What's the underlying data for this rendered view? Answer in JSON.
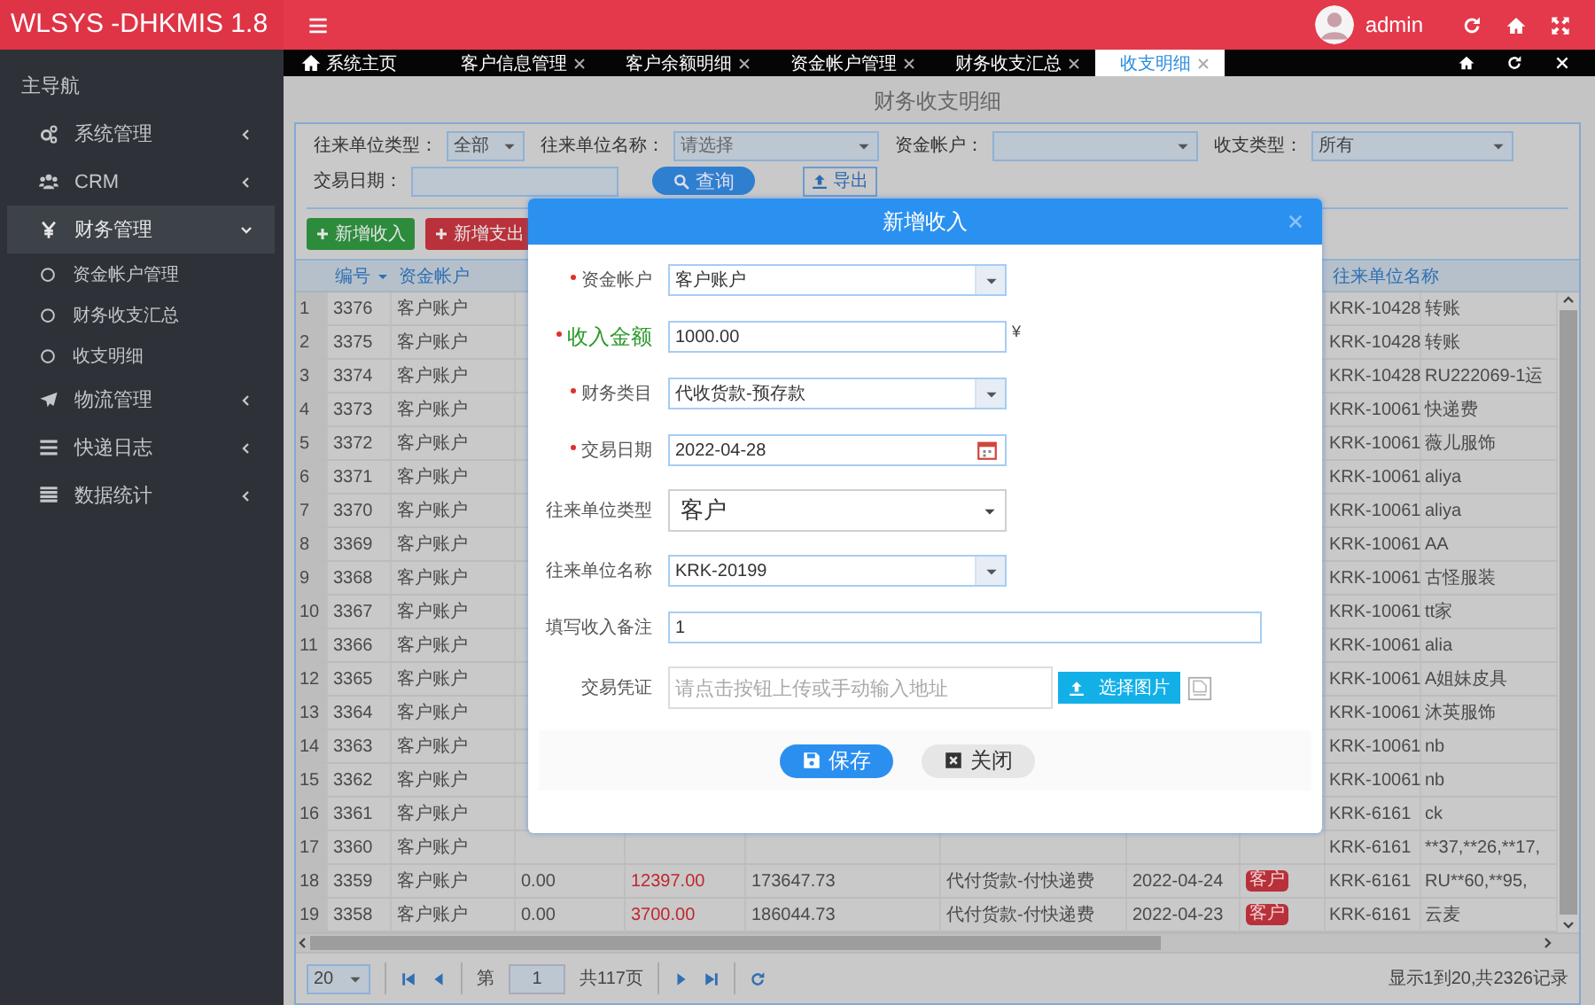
{
  "header": {
    "logo": "WLSYS -DHKMIS 1.8",
    "user": "admin"
  },
  "sidebar": {
    "heading": "主导航",
    "items": [
      {
        "label": "系统管理",
        "expanded": false
      },
      {
        "label": "CRM",
        "expanded": false
      },
      {
        "label": "财务管理",
        "expanded": true,
        "children": [
          {
            "label": "资金帐户管理"
          },
          {
            "label": "财务收支汇总"
          },
          {
            "label": "收支明细"
          }
        ]
      },
      {
        "label": "物流管理",
        "expanded": false
      },
      {
        "label": "快递日志",
        "expanded": false
      },
      {
        "label": "数据统计",
        "expanded": false
      }
    ]
  },
  "tabs": [
    {
      "label": "系统主页",
      "kind": "home",
      "selected": false
    },
    {
      "label": "客户信息管理",
      "kind": "closable",
      "selected": false
    },
    {
      "label": "客户余额明细",
      "kind": "closable",
      "selected": false
    },
    {
      "label": "资金帐户管理",
      "kind": "closable",
      "selected": false
    },
    {
      "label": "财务收支汇总",
      "kind": "closable",
      "selected": false
    },
    {
      "label": "收支明细",
      "kind": "closable",
      "selected": true
    }
  ],
  "page": {
    "title": "财务收支明细",
    "filters": [
      {
        "label": "往来单位类型：",
        "value": "全部"
      },
      {
        "label": "往来单位名称：",
        "placeholder": "请选择"
      },
      {
        "label": "资金帐户："
      },
      {
        "label": "收支类型：",
        "value": "所有"
      }
    ],
    "date_filter": {
      "label": "交易日期："
    },
    "search_button": "查询",
    "export_button": "导出",
    "actions": [
      {
        "label": "新增收入",
        "kind": "income"
      },
      {
        "label": "新增支出",
        "kind": "expense"
      }
    ],
    "table": {
      "columns": [
        {
          "label": "编号",
          "sorted": true
        },
        {
          "label": "资金帐户",
          "sorted": false
        },
        {
          "label": "往来单位名称",
          "sorted": false
        }
      ],
      "rows": [
        {
          "no": "1",
          "id": "3376",
          "account": "客户账户",
          "partner": "KRK-10428",
          "remark": "转账"
        },
        {
          "no": "2",
          "id": "3375",
          "account": "客户账户",
          "partner": "KRK-10428",
          "remark": "转账"
        },
        {
          "no": "3",
          "id": "3374",
          "account": "客户账户",
          "partner": "KRK-10428",
          "remark": "RU222069-1运"
        },
        {
          "no": "4",
          "id": "3373",
          "account": "客户账户",
          "partner": "KRK-10061",
          "remark": "快递费"
        },
        {
          "no": "5",
          "id": "3372",
          "account": "客户账户",
          "partner": "KRK-10061",
          "remark": "薇儿服饰"
        },
        {
          "no": "6",
          "id": "3371",
          "account": "客户账户",
          "partner": "KRK-10061",
          "remark": "aliya"
        },
        {
          "no": "7",
          "id": "3370",
          "account": "客户账户",
          "partner": "KRK-10061",
          "remark": "aliya"
        },
        {
          "no": "8",
          "id": "3369",
          "account": "客户账户",
          "partner": "KRK-10061",
          "remark": "AA"
        },
        {
          "no": "9",
          "id": "3368",
          "account": "客户账户",
          "partner": "KRK-10061",
          "remark": "古怪服装"
        },
        {
          "no": "10",
          "id": "3367",
          "account": "客户账户",
          "partner": "KRK-10061",
          "remark": "tt家"
        },
        {
          "no": "11",
          "id": "3366",
          "account": "客户账户",
          "partner": "KRK-10061",
          "remark": "alia"
        },
        {
          "no": "12",
          "id": "3365",
          "account": "客户账户",
          "partner": "KRK-10061",
          "remark": "A姐妹皮具"
        },
        {
          "no": "13",
          "id": "3364",
          "account": "客户账户",
          "partner": "KRK-10061",
          "remark": "沐英服饰"
        },
        {
          "no": "14",
          "id": "3363",
          "account": "客户账户",
          "partner": "KRK-10061",
          "remark": "nb"
        },
        {
          "no": "15",
          "id": "3362",
          "account": "客户账户",
          "partner": "KRK-10061",
          "remark": "nb"
        },
        {
          "no": "16",
          "id": "3361",
          "account": "客户账户",
          "partner": "KRK-6161",
          "remark": "ck"
        },
        {
          "no": "17",
          "id": "3360",
          "account": "客户账户",
          "partner": "KRK-6161",
          "remark": "**37,**26,**17,"
        },
        {
          "no": "18",
          "id": "3359",
          "account": "客户账户",
          "column_4": "0.00",
          "column_5": "12397.00",
          "column_6": "173647.73",
          "column_7": "代付货款-付快递费",
          "column_8": "2022-04-24",
          "column_9": "客户",
          "partner": "KRK-6161",
          "remark": "RU**60,**95,"
        },
        {
          "no": "19",
          "id": "3358",
          "account": "客户账户",
          "column_4": "0.00",
          "column_5": "3700.00",
          "column_6": "186044.73",
          "column_7": "代付货款-付快递费",
          "column_8": "2022-04-23",
          "column_9": "客户",
          "partner": "KRK-6161",
          "remark": "云麦"
        }
      ]
    },
    "pager": {
      "page_size": "20",
      "page_prefix": "第",
      "page": "1",
      "page_total": "共117页",
      "summary": "显示1到20,共2326记录"
    }
  },
  "dialog": {
    "title": "新增收入",
    "fields": [
      {
        "label": "资金帐户",
        "required": true,
        "emphasized": false,
        "kind": "combo",
        "value": "客户账户"
      },
      {
        "label": "收入金额",
        "required": true,
        "emphasized": true,
        "kind": "text",
        "value": "1000.00",
        "suffix": "¥"
      },
      {
        "label": "财务类目",
        "required": true,
        "emphasized": false,
        "kind": "combo",
        "value": "代收货款-预存款"
      },
      {
        "label": "交易日期",
        "required": true,
        "emphasized": false,
        "kind": "date",
        "value": "2022-04-28"
      },
      {
        "label": "往来单位类型",
        "required": false,
        "emphasized": false,
        "kind": "select",
        "value": "客户"
      },
      {
        "label": "往来单位名称",
        "required": false,
        "emphasized": false,
        "kind": "combo",
        "value": "KRK-20199"
      },
      {
        "label": "填写收入备注",
        "required": false,
        "emphasized": false,
        "kind": "wide",
        "value": "1"
      },
      {
        "label": "交易凭证",
        "required": false,
        "emphasized": false,
        "kind": "upload",
        "placeholder": "请点击按钮上传或手动输入地址",
        "button": "选择图片"
      }
    ],
    "buttons": [
      {
        "label": "保存",
        "kind": "primary"
      },
      {
        "label": "关闭",
        "kind": "secondary"
      }
    ]
  }
}
